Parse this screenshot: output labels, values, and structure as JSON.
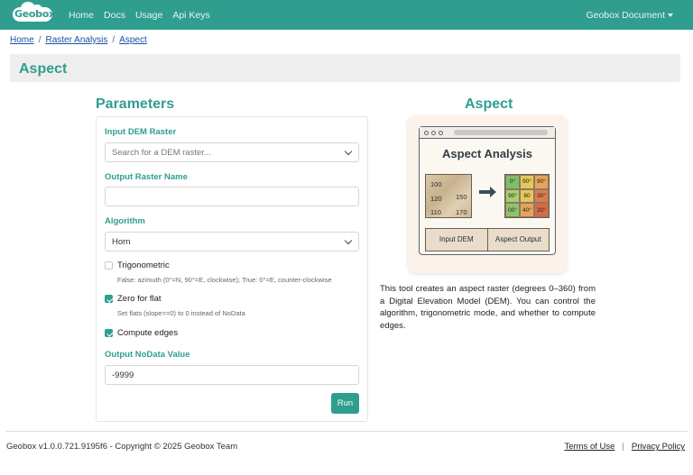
{
  "navbar": {
    "logo_text": "Geobox",
    "links": [
      "Home",
      "Docs",
      "Usage",
      "Api Keys"
    ],
    "user_menu": "Geobox Document"
  },
  "breadcrumb": [
    "Home",
    "Raster Analysis",
    "Aspect"
  ],
  "page_title": "Aspect",
  "params": {
    "title": "Parameters",
    "dem_label": "Input DEM Raster",
    "dem_placeholder": "Search for a DEM raster...",
    "output_label": "Output Raster Name",
    "output_value": "",
    "algorithm_label": "Algorithm",
    "algorithm_value": "Horn",
    "trig_label": "Trigonometric",
    "trig_checked": false,
    "trig_hint": "False: azimuth (0°=N, 90°=E, clockwise); True: 0°=E, counter-clockwise",
    "zero_label": "Zero for flat",
    "zero_checked": true,
    "zero_hint": "Set flats (slope==0) to 0 instead of NoData",
    "edges_label": "Compute edges",
    "edges_checked": true,
    "nodata_label": "Output NoData Value",
    "nodata_value": "-9999",
    "run_label": "Run"
  },
  "info": {
    "title": "Aspect",
    "illustration": {
      "heading": "Aspect Analysis",
      "dem_values": [
        "100",
        "120",
        "150",
        "110",
        "170"
      ],
      "output_cells": [
        "0°",
        "90°",
        "90°",
        "90°",
        "80",
        "30°",
        "00°",
        "40°",
        "20°"
      ],
      "cell_colors": [
        "#7fbf6a",
        "#e8c75a",
        "#e8a35a",
        "#a9cf6e",
        "#e8c75a",
        "#e07a4a",
        "#8fc46a",
        "#e8a35a",
        "#d96a45"
      ],
      "input_label": "Input DEM",
      "output_label": "Aspect Output"
    },
    "description": "This tool creates an aspect raster (degrees 0–360) from a Digital Elevation Model (DEM). You can control the algorithm, trigonometric mode, and whether to compute edges."
  },
  "footer": {
    "copyright": "Geobox v1.0.0.721.9195f6 - Copyright © 2025 Geobox Team",
    "terms": "Terms of Use",
    "privacy": "Privacy Policy"
  },
  "colors": {
    "brand": "#2f9e8f",
    "link": "#1d4fa3"
  }
}
